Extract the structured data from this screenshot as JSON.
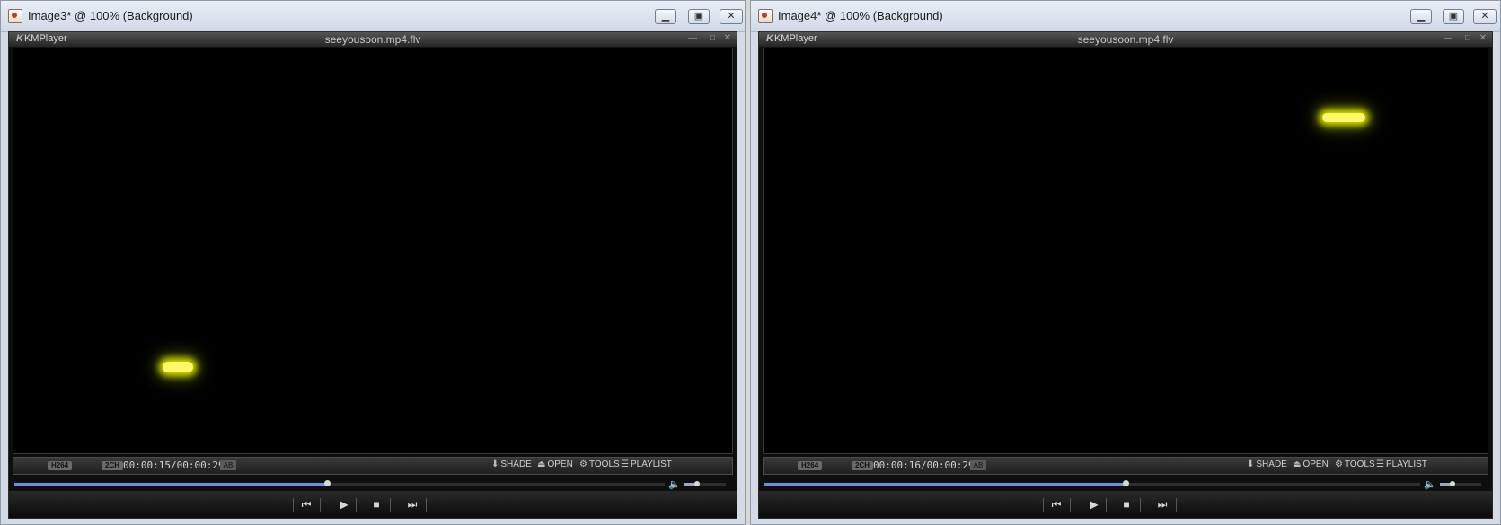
{
  "windows": [
    {
      "title": "Image3* @ 100% (Background)",
      "player": {
        "brand": "KMPlayer",
        "filename": "seeyousoon.mp4.flv",
        "codec_badge": "H264",
        "channel_badge": "2CH",
        "time": "00:00:15/00:00:29",
        "ab_label": "AB",
        "menu": {
          "shade": "SHADE",
          "open": "OPEN",
          "tools": "TOOLS",
          "playlist": "PLAYLIST"
        },
        "progress": 0.48,
        "volume": 0.3
      }
    },
    {
      "title": "Image4* @ 100% (Background)",
      "player": {
        "brand": "KMPlayer",
        "filename": "seeyousoon.mp4.flv",
        "codec_badge": "H264",
        "channel_badge": "2CH",
        "time": "00:00:16/00:00:29",
        "ab_label": "AB",
        "menu": {
          "shade": "SHADE",
          "open": "OPEN",
          "tools": "TOOLS",
          "playlist": "PLAYLIST"
        },
        "progress": 0.55,
        "volume": 0.3
      }
    }
  ],
  "icons": {
    "minimize": "minimize-icon",
    "maximize": "maximize-icon",
    "close": "close-icon",
    "prev": "previous-track-icon",
    "play": "play-icon",
    "stop": "stop-icon",
    "next": "next-track-icon",
    "volume": "speaker-icon"
  },
  "colors": {
    "glow": "#fff66a",
    "seek": "#6e8fd8"
  }
}
